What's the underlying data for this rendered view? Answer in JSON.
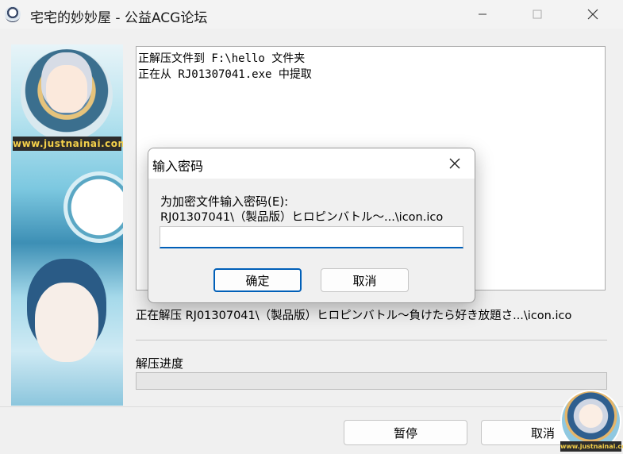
{
  "window": {
    "title": "宅宅的妙妙屋 - 公益ACG论坛"
  },
  "side_art": {
    "watermark": "www.justnainai.com"
  },
  "log": {
    "lines": [
      "正解压文件到 F:\\hello 文件夹",
      "正在从 RJ01307041.exe 中提取"
    ]
  },
  "status": {
    "text": "正在解压 RJ01307041\\（製品版）ヒロピンバトル～負けたら好き放題さ...\\icon.ico"
  },
  "progress": {
    "label": "解压进度",
    "fraction": 0
  },
  "footer": {
    "pause_label": "暂停",
    "cancel_label": "取消",
    "badge_watermark": "www.justnainai.com"
  },
  "dialog": {
    "title": "输入密码",
    "prompt": "为加密文件输入密码(E):",
    "file": "RJ01307041\\（製品版）ヒロピンバトル～...\\icon.ico",
    "password_value": "",
    "ok_label": "确定",
    "cancel_label": "取消"
  },
  "colors": {
    "accent": "#005fb8",
    "background": "#f0f0f0"
  }
}
